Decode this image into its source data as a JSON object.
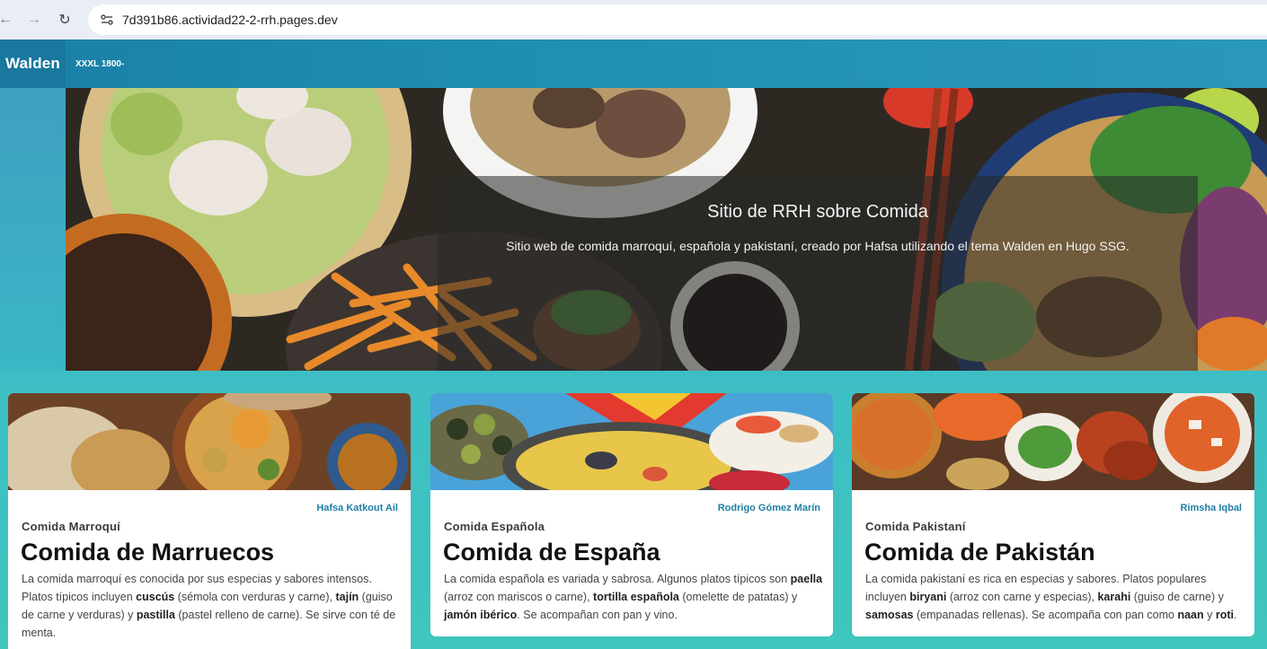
{
  "browser": {
    "url": "7d391b86.actividad22-2-rrh.pages.dev",
    "back_glyph": "←",
    "forward_glyph": "→",
    "reload_glyph": "↻"
  },
  "header": {
    "brand": "Walden",
    "tagline": "XXXL 1800-"
  },
  "hero": {
    "title": "Sitio de RRH sobre Comida",
    "subtitle": "Sitio web de comida marroquí, española y pakistaní, creado por Hafsa utilizando el tema Walden en Hugo SSG."
  },
  "cards": [
    {
      "author": "Hafsa Katkout Ail",
      "category": "Comida Marroquí",
      "title": "Comida de Marruecos",
      "text": [
        "La comida marroquí es conocida por sus especias y sabores intensos. Platos típicos incluyen ",
        "cuscús",
        " (sémola con verduras y carne), ",
        "tajín",
        " (guiso de carne y verduras) y ",
        "pastilla",
        " (pastel relleno de carne). Se sirve con té de menta."
      ]
    },
    {
      "author": "Rodrigo Gómez Marín",
      "category": "Comida Española",
      "title": "Comida de España",
      "text": [
        "La comida española es variada y sabrosa. Algunos platos típicos son ",
        "paella",
        " (arroz con mariscos o carne), ",
        "tortilla española",
        " (omelette de patatas) y ",
        "jamón ibérico",
        ". Se acompañan con pan y vino."
      ]
    },
    {
      "author": "Rimsha Iqbal",
      "category": "Comida Pakistaní",
      "title": "Comida de Pakistán",
      "text": [
        "La comida pakistaní es rica en especias y sabores. Platos populares incluyen ",
        "biryani",
        " (arroz con carne y especias), ",
        "karahi",
        " (guiso de carne) y ",
        "samosas",
        " (empanadas rellenas). Se acompaña con pan como ",
        "naan",
        " y ",
        "roti",
        "."
      ]
    }
  ]
}
